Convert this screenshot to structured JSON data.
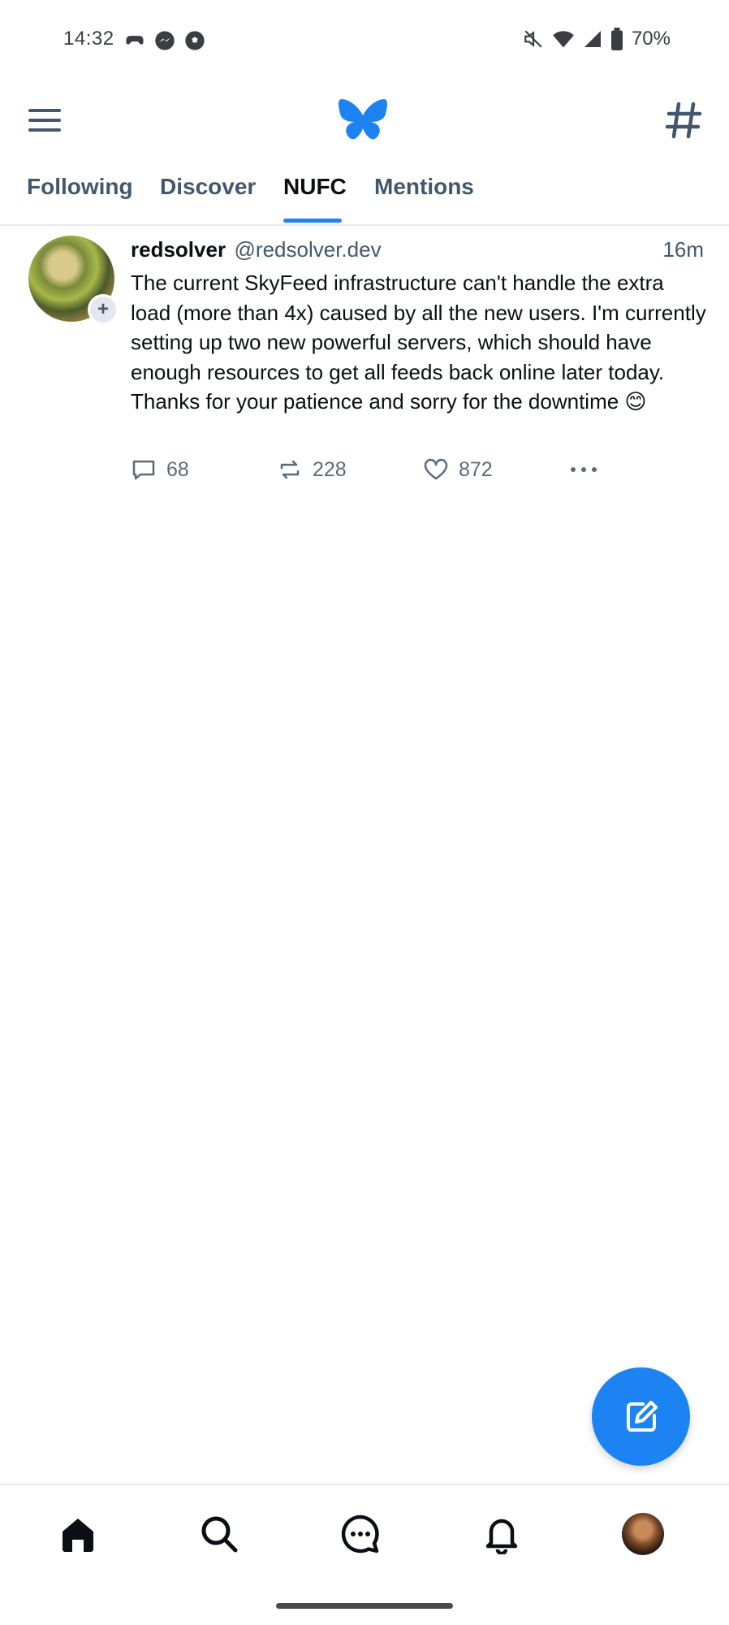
{
  "status_bar": {
    "time": "14:32",
    "battery": "70%",
    "left_icons": [
      "game-controller-icon",
      "messenger-icon",
      "football-icon"
    ],
    "right_icons": [
      "mute-icon",
      "wifi-icon",
      "signal-icon",
      "battery-icon"
    ]
  },
  "top_bar": {
    "menu_icon": "hamburger-menu-icon",
    "logo": "butterfly-logo",
    "feeds_icon": "hashtag-icon"
  },
  "tabs": [
    {
      "label": "Following",
      "active": false
    },
    {
      "label": "Discover",
      "active": false
    },
    {
      "label": "NUFC",
      "active": true
    },
    {
      "label": "Mentions",
      "active": false
    }
  ],
  "post": {
    "author_name": "redsolver",
    "author_handle": "@redsolver.dev",
    "time": "16m",
    "text": "The current SkyFeed infrastructure can't handle the extra load (more than 4x) caused by all the new users. I'm currently setting up two new powerful servers, which should have enough resources to get all feeds back online later today. Thanks for your patience and sorry for the downtime 😊",
    "replies": "68",
    "reposts": "228",
    "likes": "872",
    "follow_badge": "+"
  },
  "bottom_nav": {
    "items": [
      "home-icon",
      "search-icon",
      "chat-icon",
      "bell-icon",
      "profile-avatar"
    ]
  },
  "colors": {
    "accent": "#1d83f3",
    "text_secondary": "#42576c",
    "divider": "#e6e9ee"
  }
}
